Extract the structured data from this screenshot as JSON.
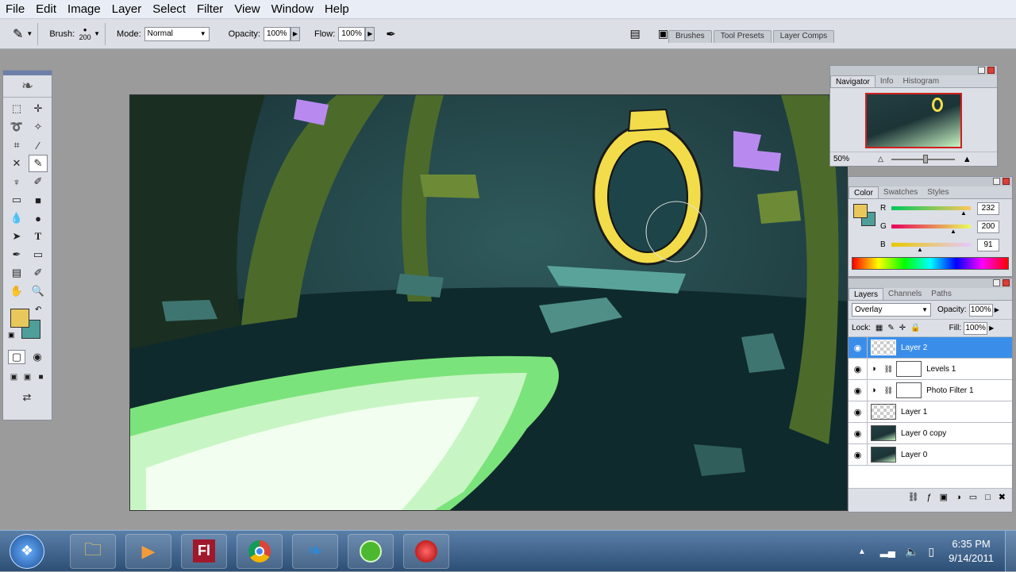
{
  "menu": [
    "File",
    "Edit",
    "Image",
    "Layer",
    "Select",
    "Filter",
    "View",
    "Window",
    "Help"
  ],
  "options": {
    "brush_label": "Brush:",
    "brush_size": "200",
    "mode_label": "Mode:",
    "mode_value": "Normal",
    "opacity_label": "Opacity:",
    "opacity_value": "100%",
    "flow_label": "Flow:",
    "flow_value": "100%"
  },
  "palette_well": [
    "Brushes",
    "Tool Presets",
    "Layer Comps"
  ],
  "navigator": {
    "tabs": [
      "Navigator",
      "Info",
      "Histogram"
    ],
    "zoom": "50%"
  },
  "color_panel": {
    "tabs": [
      "Color",
      "Swatches",
      "Styles"
    ],
    "channels": [
      {
        "name": "R",
        "value": "232",
        "fraction": 0.91
      },
      {
        "name": "G",
        "value": "200",
        "fraction": 0.78
      },
      {
        "name": "B",
        "value": "91",
        "fraction": 0.36
      }
    ],
    "foreground": "#e8c85b",
    "background": "#4e9e9a"
  },
  "layers_panel": {
    "tabs": [
      "Layers",
      "Channels",
      "Paths"
    ],
    "blend_mode": "Overlay",
    "opacity_label": "Opacity:",
    "opacity_value": "100%",
    "lock_label": "Lock:",
    "fill_label": "Fill:",
    "fill_value": "100%",
    "layers": [
      {
        "name": "Layer 2",
        "type": "pixel",
        "selected": true
      },
      {
        "name": "Levels 1",
        "type": "adjustment",
        "selected": false
      },
      {
        "name": "Photo Filter 1",
        "type": "adjustment",
        "selected": false
      },
      {
        "name": "Layer 1",
        "type": "pixel",
        "selected": false
      },
      {
        "name": "Layer 0 copy",
        "type": "image",
        "selected": false
      },
      {
        "name": "Layer 0",
        "type": "image",
        "selected": false
      }
    ]
  },
  "taskbar": {
    "apps": [
      "windows-explorer",
      "media-player",
      "flash",
      "chrome",
      "photoshop",
      "camtasia",
      "recorder"
    ],
    "time": "6:35 PM",
    "date": "9/14/2011"
  }
}
